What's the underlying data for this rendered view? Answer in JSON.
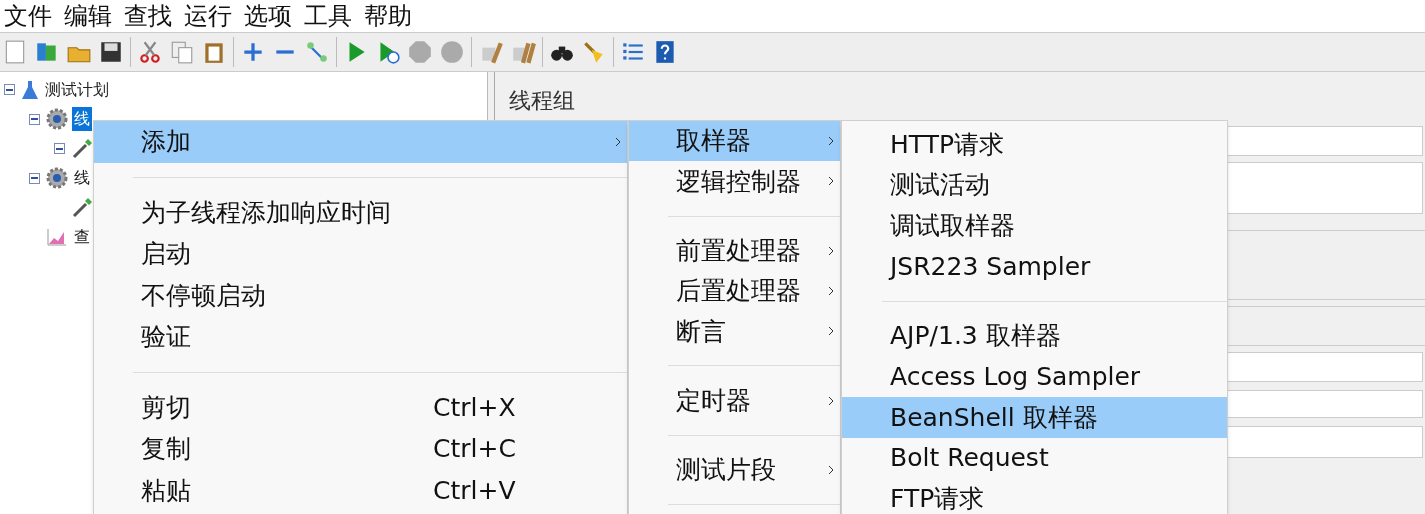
{
  "menubar": [
    "文件",
    "编辑",
    "查找",
    "运行",
    "选项",
    "工具",
    "帮助"
  ],
  "tree": [
    {
      "label": "测试计划",
      "kind": "plan",
      "expanded": true,
      "children": [
        {
          "label": "线",
          "kind": "thread-group",
          "selected": true,
          "expanded": true,
          "children": [
            {
              "kind": "sampler",
              "expanded": true
            }
          ]
        },
        {
          "label": "线",
          "kind": "thread-group",
          "selected": false,
          "expanded": true,
          "children": [
            {
              "kind": "sampler"
            }
          ]
        },
        {
          "label": "查",
          "kind": "listener",
          "selected": false,
          "expanded": false
        }
      ]
    }
  ],
  "panel": {
    "title": "线程组"
  },
  "context_menu": [
    {
      "kind": "item",
      "label": "添加",
      "submenu": true,
      "selected": true
    },
    {
      "kind": "separator"
    },
    {
      "kind": "item",
      "label": "为子线程添加响应时间",
      "submenu": false,
      "selected": false
    },
    {
      "kind": "item",
      "label": "启动",
      "submenu": false,
      "selected": false
    },
    {
      "kind": "item",
      "label": "不停顿启动",
      "submenu": false,
      "selected": false
    },
    {
      "kind": "item",
      "label": "验证",
      "submenu": false,
      "selected": false
    },
    {
      "kind": "separator"
    },
    {
      "kind": "item",
      "label": "剪切",
      "shortcut": "Ctrl+X",
      "submenu": false,
      "selected": false
    },
    {
      "kind": "item",
      "label": "复制",
      "shortcut": "Ctrl+C",
      "submenu": false,
      "selected": false
    },
    {
      "kind": "item",
      "label": "粘贴",
      "shortcut": "Ctrl+V",
      "submenu": false,
      "selected": false
    }
  ],
  "add_menu": [
    {
      "kind": "item",
      "label": "取样器",
      "submenu": true,
      "selected": true
    },
    {
      "kind": "item",
      "label": "逻辑控制器",
      "submenu": true,
      "selected": false
    },
    {
      "kind": "separator"
    },
    {
      "kind": "item",
      "label": "前置处理器",
      "submenu": true,
      "selected": false
    },
    {
      "kind": "item",
      "label": "后置处理器",
      "submenu": true,
      "selected": false
    },
    {
      "kind": "item",
      "label": "断言",
      "submenu": true,
      "selected": false
    },
    {
      "kind": "separator"
    },
    {
      "kind": "item",
      "label": "定时器",
      "submenu": true,
      "selected": false
    },
    {
      "kind": "separator"
    },
    {
      "kind": "item",
      "label": "测试片段",
      "submenu": true,
      "selected": false
    },
    {
      "kind": "separator"
    }
  ],
  "sampler_menu": [
    {
      "kind": "item",
      "label": "HTTP请求",
      "submenu": false,
      "selected": false
    },
    {
      "kind": "item",
      "label": "测试活动",
      "submenu": false,
      "selected": false
    },
    {
      "kind": "item",
      "label": "调试取样器",
      "submenu": false,
      "selected": false
    },
    {
      "kind": "item",
      "label": "JSR223 Sampler",
      "submenu": false,
      "selected": false
    },
    {
      "kind": "separator"
    },
    {
      "kind": "item",
      "label": "AJP/1.3 取样器",
      "submenu": false,
      "selected": false
    },
    {
      "kind": "item",
      "label": "Access Log Sampler",
      "submenu": false,
      "selected": false
    },
    {
      "kind": "item",
      "label": "BeanShell 取样器",
      "submenu": false,
      "selected": true
    },
    {
      "kind": "item",
      "label": "Bolt Request",
      "submenu": false,
      "selected": false
    },
    {
      "kind": "item",
      "label": "FTP请求",
      "submenu": false,
      "selected": false
    }
  ]
}
